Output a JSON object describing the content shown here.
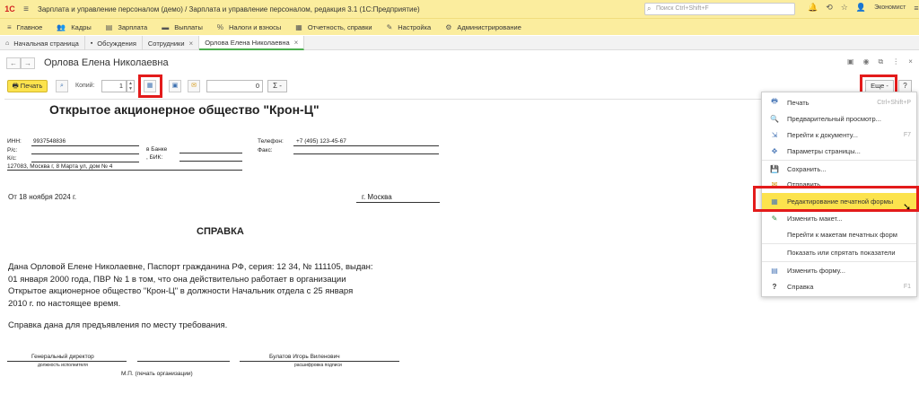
{
  "app": {
    "logo": "1С",
    "title": "Зарплата и управление персоналом (демо) / Зарплата и управление персоналом, редакция 3.1  (1С:Предприятие)",
    "search_placeholder": "Поиск Ctrl+Shift+F",
    "user": "Экономист"
  },
  "menu_bar": [
    {
      "icon": "≡",
      "label": "Главное"
    },
    {
      "icon": "👥",
      "label": "Кадры"
    },
    {
      "icon": "▤",
      "label": "Зарплата"
    },
    {
      "icon": "▬",
      "label": "Выплаты"
    },
    {
      "icon": "%",
      "label": "Налоги и взносы"
    },
    {
      "icon": "▦",
      "label": "Отчетность, справки"
    },
    {
      "icon": "✎",
      "label": "Настройка"
    },
    {
      "icon": "⚙",
      "label": "Администрирование"
    }
  ],
  "tabs": [
    {
      "icon": "⌂",
      "label": "Начальная страница"
    },
    {
      "icon": "▪",
      "label": "Обсуждения"
    },
    {
      "label": "Сотрудники",
      "close": "×"
    },
    {
      "label": "Орлова Елена Николаевна",
      "close": "×"
    }
  ],
  "header": {
    "back": "←",
    "forward": "→",
    "title": "Орлова Елена Николаевна"
  },
  "toolbar": {
    "print_label": "Печать",
    "copies_label": "Копий:",
    "copies_value": "1",
    "sum_value": "0",
    "sigma_label": "Σ -",
    "more_label": "Еще -",
    "help_label": "?"
  },
  "document": {
    "org_name": "Открытое акционерное общество \"Крон-Ц\"",
    "inn_label": "ИНН:",
    "inn_value": "9937548836",
    "rs_label": "Р/с:",
    "ks_label": "К/с:",
    "bank_label": "в Банке",
    "bik_label": ", БИК:",
    "address": "127083, Москва г, 8 Марта ул, дом № 4",
    "phone_label": "Телефон:",
    "phone_value": "+7 (495) 123-45-67",
    "fax_label": "Факс:",
    "date": "От 18 ноября 2024 г.",
    "city": "г. Москва",
    "heading": "СПРАВКА",
    "body": [
      "Дана Орловой Елене Николаевне, Паспорт гражданина РФ, серия: 12 34, № 111105, выдан:",
      "01 января 2000 года, ПВР № 1 в том, что она действительно работает в организации",
      "Открытое акционерное общество \"Крон-Ц\" в должности Начальник отдела с 25 января",
      "2010 г. по настоящее время."
    ],
    "purpose": "Справка дана для предъявления по месту требования.",
    "director_title": "Генеральный директор",
    "position_caption": "должность исполнителя",
    "director_name": "Булатов Игорь Виленович",
    "signature_caption": "расшифровка подписи",
    "stamp": "М.П. (печать организации)"
  },
  "more_menu": [
    {
      "icon": "🖶",
      "label": "Печать",
      "shortcut": "Ctrl+Shift+P"
    },
    {
      "icon": "🔍",
      "label": "Предварительный просмотр..."
    },
    {
      "icon": "⇲",
      "label": "Перейти к документу...",
      "shortcut": "F7"
    },
    {
      "icon": "✥",
      "label": "Параметры страницы..."
    },
    {
      "icon": "💾",
      "label": "Сохранить..."
    },
    {
      "icon": "✉",
      "label": "Отправить..."
    },
    {
      "icon": "▦",
      "label": "Редактирование печатной формы",
      "highlighted": true
    },
    {
      "icon": "✎",
      "label": "Изменить макет..."
    },
    {
      "label": "Перейти к макетам печатных форм"
    },
    {
      "label": "Показать или спрятать показатели"
    },
    {
      "icon": "▤",
      "label": "Изменить форму..."
    },
    {
      "icon": "?",
      "label": "Справка",
      "shortcut": "F1"
    }
  ]
}
